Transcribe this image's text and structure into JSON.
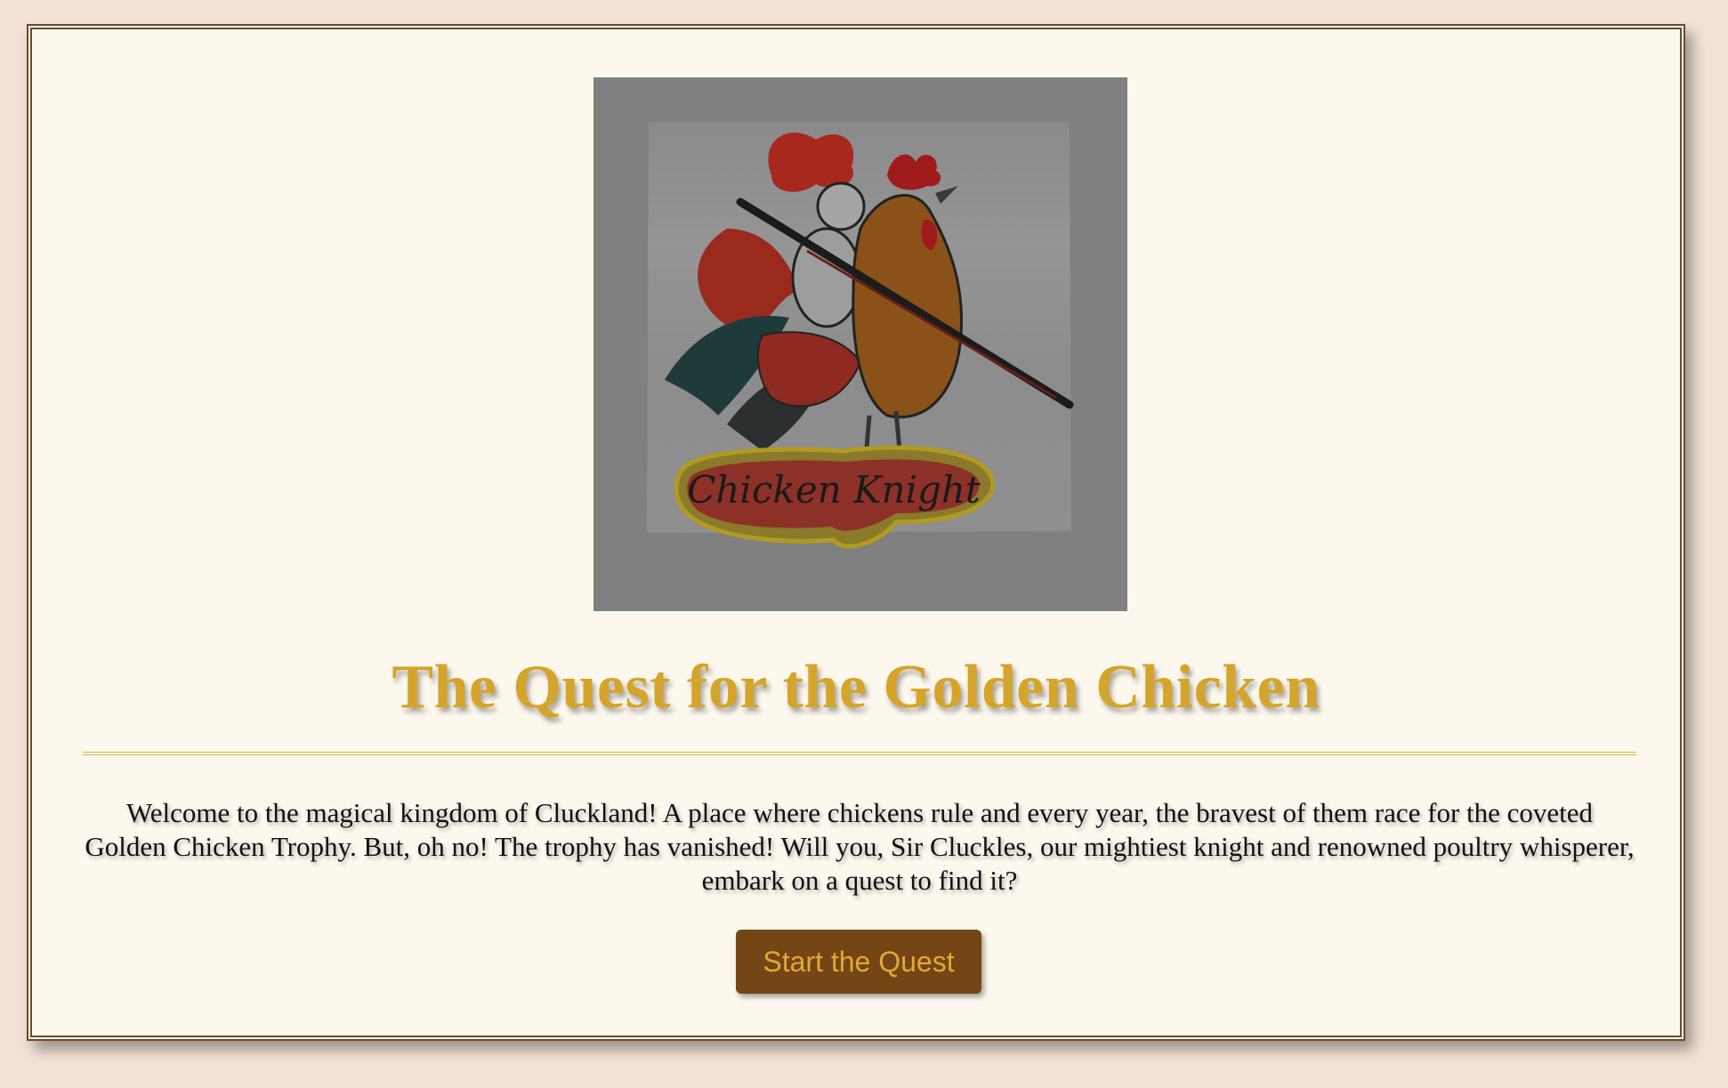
{
  "page": {
    "title": "The Quest for the Golden Chicken",
    "intro": "Welcome to the magical kingdom of Cluckland! A place where chickens rule and every year, the bravest of them race for the coveted Golden Chicken Trophy. But, oh no! The trophy has vanished! Will you, Sir Cluckles, our mightiest knight and renowned poultry whisperer, embark on a quest to find it?",
    "start_button_label": "Start the Quest"
  },
  "hero_image": {
    "logo_text": "Chicken Knight"
  },
  "colors": {
    "background": "#f3e1d6",
    "panel": "#fdf8ee",
    "border": "#6b4a2a",
    "title_gold": "#d4a52a",
    "button_bg": "#744515",
    "button_text": "#e2a836"
  }
}
